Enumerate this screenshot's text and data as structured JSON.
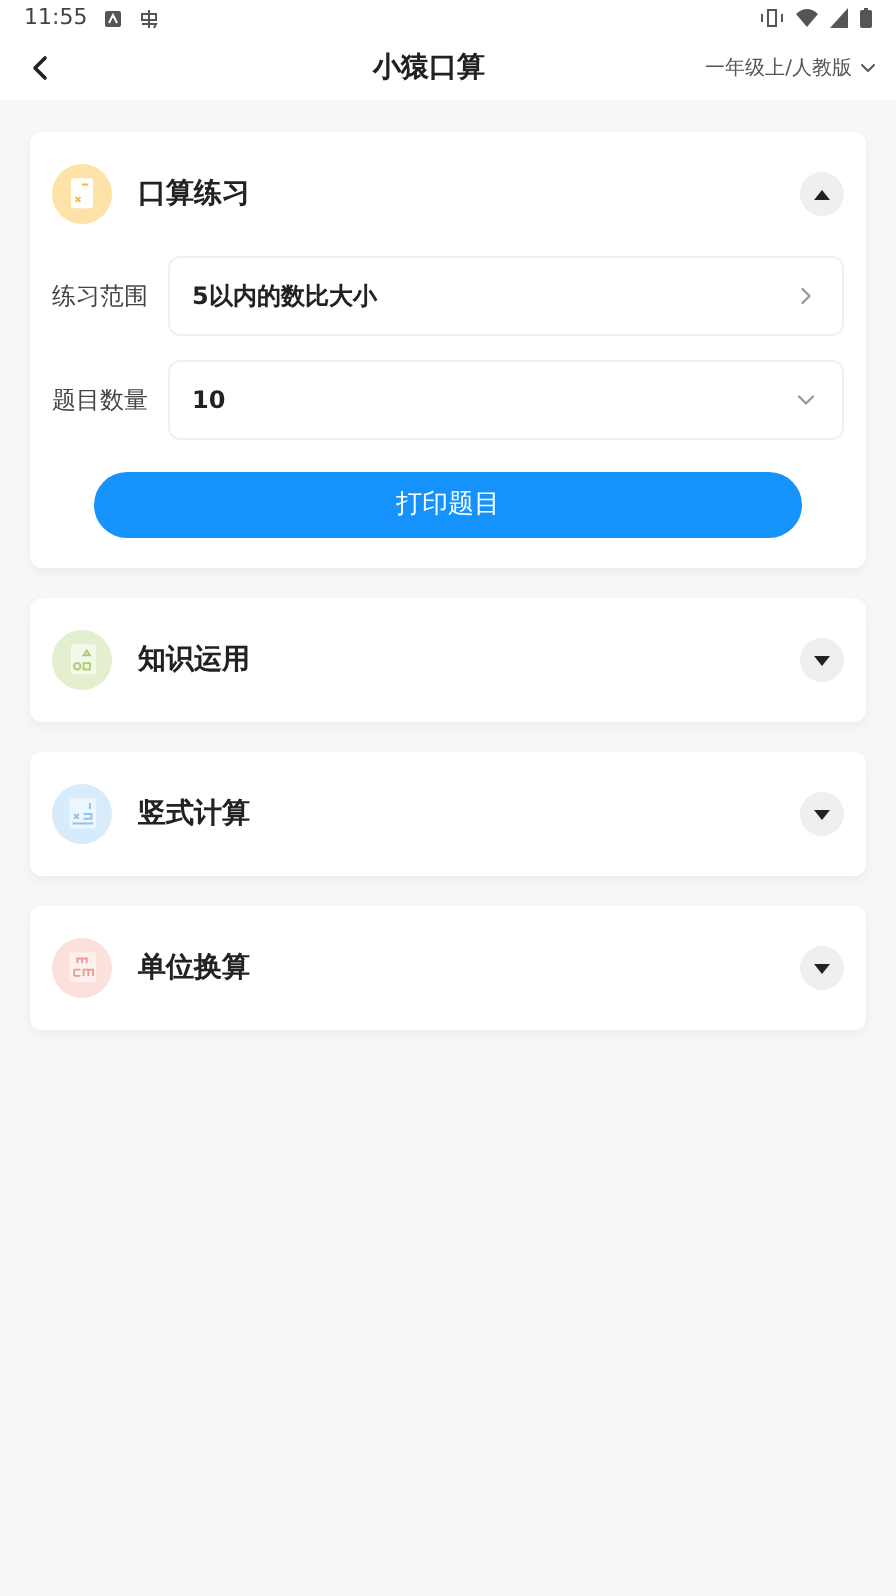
{
  "status_bar": {
    "time": "11:55"
  },
  "header": {
    "title": "小猿口算",
    "grade": "一年级上/人教版"
  },
  "sections": [
    {
      "title": "口算练习",
      "kind": "calc",
      "color": "#fde3a7",
      "expanded": true,
      "fields": [
        {
          "label": "练习范围",
          "value": "5以内的数比大小",
          "kind": "link"
        },
        {
          "label": "题目数量",
          "value": "10",
          "kind": "select"
        }
      ],
      "button": "打印题目"
    },
    {
      "title": "知识运用",
      "kind": "shapes",
      "color": "#e3efcf",
      "expanded": false
    },
    {
      "title": "竖式计算",
      "kind": "vertical",
      "color": "#d8ebfb",
      "expanded": false
    },
    {
      "title": "单位换算",
      "kind": "unit",
      "color": "#fbe0dc",
      "expanded": false
    }
  ]
}
